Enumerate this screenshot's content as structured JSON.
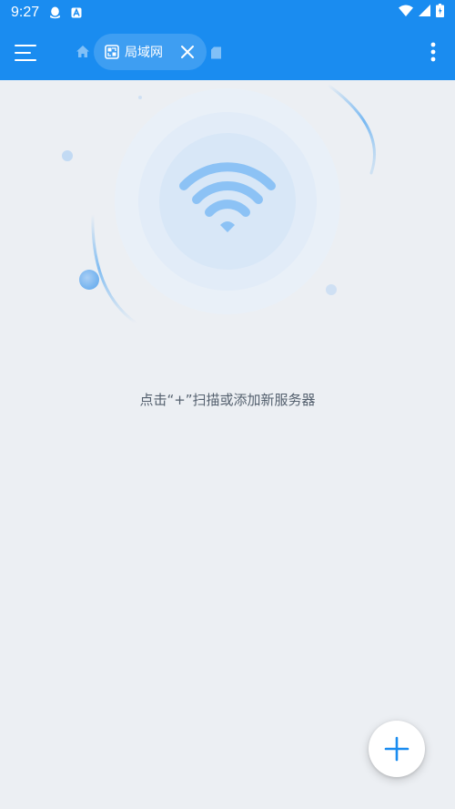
{
  "status": {
    "time": "9:27",
    "left_icons": [
      "qq-icon",
      "app-a-icon"
    ],
    "right_icons": [
      "wifi-icon",
      "cellular-icon",
      "battery-icon"
    ]
  },
  "appbar": {
    "tab_label": "局域网",
    "menu_icon": "hamburger-menu-icon",
    "home_icon": "home-icon",
    "tab_icon": "lan-icon",
    "close_icon": "close-icon",
    "sd_icon": "sd-card-icon",
    "more_icon": "more-vertical-icon"
  },
  "main": {
    "empty_message": "点击“+”扫描或添加新服务器",
    "illustration_icon": "wifi-icon"
  },
  "fab": {
    "icon": "plus-icon"
  },
  "colors": {
    "primary": "#1a8cf0",
    "background": "#eceff3",
    "message_text": "#54606e",
    "fab_plus": "#1a8cf0"
  }
}
